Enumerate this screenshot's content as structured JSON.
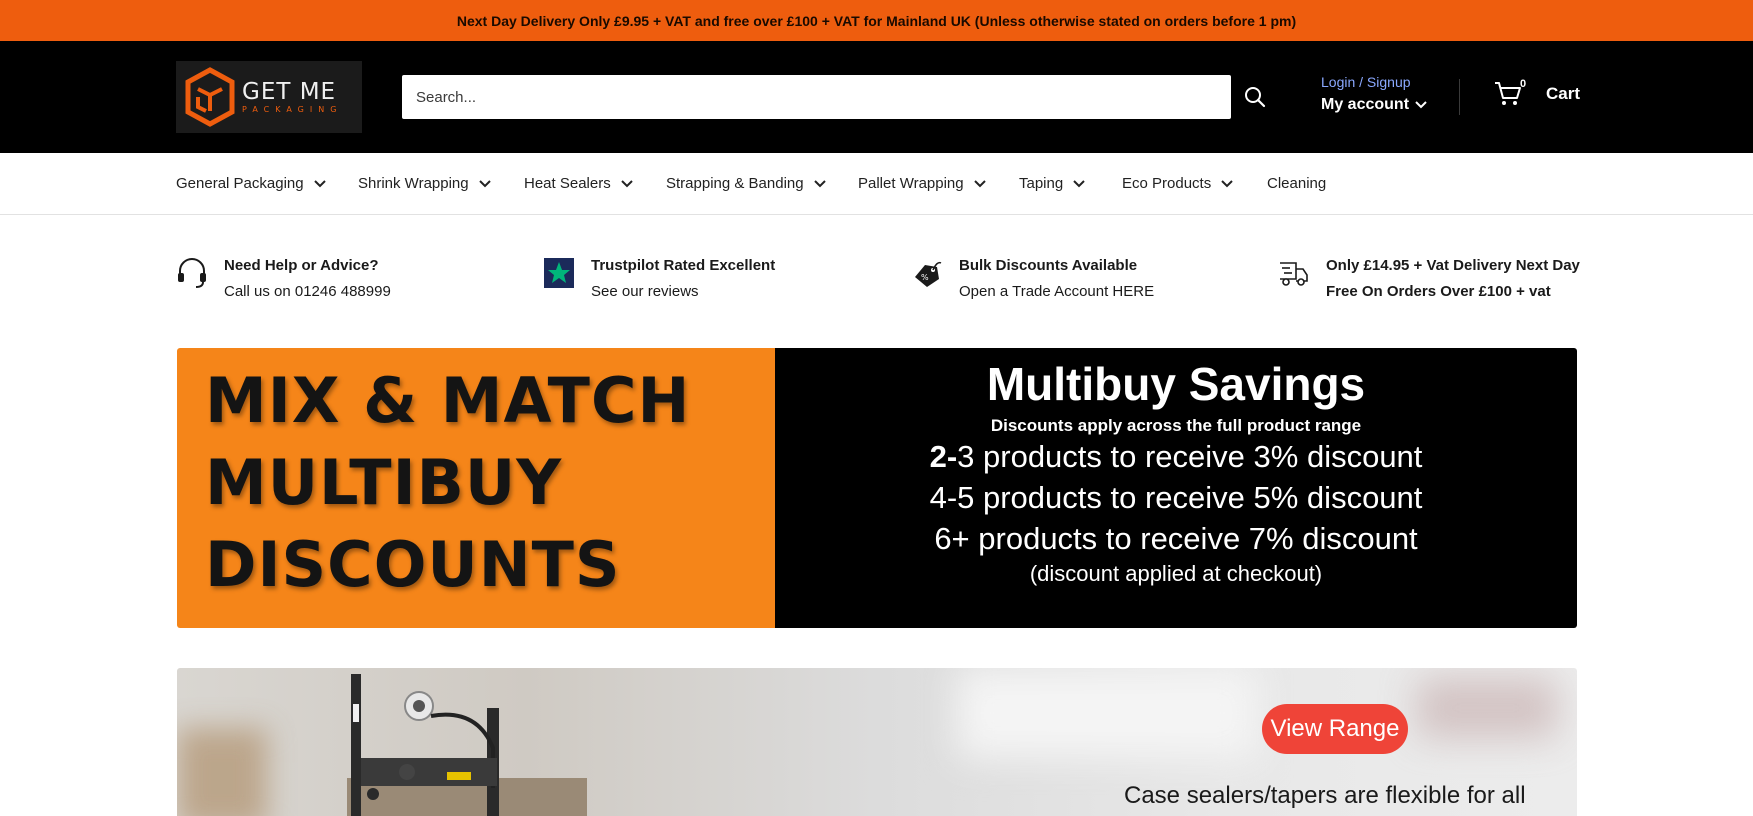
{
  "announcement": "Next Day Delivery Only £9.95 + VAT and free over £100 + VAT for Mainland UK (Unless otherwise stated on orders before 1 pm)",
  "logo": {
    "main": "GET ME",
    "sub": "PACKAGING"
  },
  "search": {
    "placeholder": "Search..."
  },
  "account": {
    "login": "Login / Signup",
    "label": "My account"
  },
  "cart": {
    "count": "0",
    "label": "Cart"
  },
  "nav": [
    {
      "label": "General Packaging"
    },
    {
      "label": "Shrink Wrapping"
    },
    {
      "label": "Heat Sealers"
    },
    {
      "label": "Strapping & Banding"
    },
    {
      "label": "Pallet Wrapping"
    },
    {
      "label": "Taping"
    },
    {
      "label": "Eco Products"
    },
    {
      "label": "Cleaning"
    }
  ],
  "features": [
    {
      "title": "Need Help or Advice?",
      "sub": "Call us on 01246 488999",
      "icon": "headset-icon"
    },
    {
      "title": "Trustpilot Rated Excellent",
      "sub": "See our reviews",
      "icon": "trustpilot-star-icon"
    },
    {
      "title": "Bulk Discounts Available",
      "sub": "Open a Trade Account HERE",
      "icon": "discount-tag-icon"
    },
    {
      "title": "Only £14.95 + Vat Delivery Next Day",
      "sub": "Free On Orders Over £100 + vat",
      "icon": "delivery-truck-icon"
    }
  ],
  "promo": {
    "left_lines": [
      "MIX & MATCH",
      "MULTIBUY",
      "DISCOUNTS"
    ],
    "title": "Multibuy Savings",
    "subtitle": "Discounts apply across the full product range",
    "line1_bold": "2-",
    "line1_rest": "3 products to receive 3% discount",
    "line2": "4-5 products to receive 5% discount",
    "line3": "6+ products to receive 7% discount",
    "note": "(discount applied at checkout)"
  },
  "hero": {
    "button": "View Range",
    "text": "Case sealers/tapers are flexible for all"
  },
  "colors": {
    "accent": "#ee5d0e",
    "promo_orange": "#f58519",
    "button_red": "#ef4438",
    "link_blue": "#8aa8ff"
  }
}
